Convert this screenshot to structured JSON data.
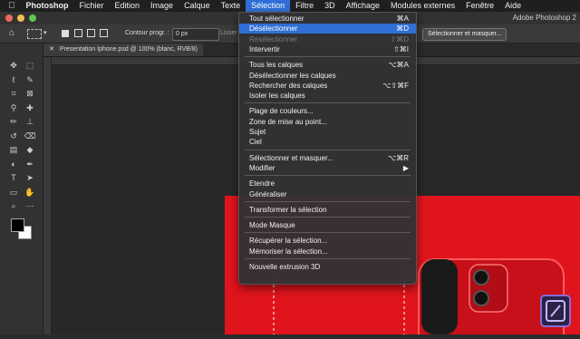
{
  "menubar": {
    "apple": "",
    "items": [
      "Photoshop",
      "Fichier",
      "Edition",
      "Image",
      "Calque",
      "Texte",
      "Sélection",
      "Filtre",
      "3D",
      "Affichage",
      "Modules externes",
      "Fenêtre",
      "Aide"
    ],
    "active": "Sélection",
    "colors": {
      "active": "#2f6fd6"
    }
  },
  "window": {
    "app_title": "Adobe Photoshop 2"
  },
  "options": {
    "contour_label": "Contour progr. :",
    "contour_value": "0 px",
    "lisser_label": "Lisser",
    "select_mask_button": "Sélectionner et masquer..."
  },
  "document": {
    "tab_label": "Presentation Iphone.psd @ 100% (blanc, RVB/8)"
  },
  "selection_menu": {
    "groups": [
      [
        {
          "label": "Tout sélectionner",
          "shortcut": "⌘A",
          "state": "normal"
        },
        {
          "label": "Désélectionner",
          "shortcut": "⌘D",
          "state": "highlighted"
        },
        {
          "label": "Resélectionner",
          "shortcut": "⇧⌘D",
          "state": "disabled"
        },
        {
          "label": "Intervertir",
          "shortcut": "⇧⌘I",
          "state": "normal"
        }
      ],
      [
        {
          "label": "Tous les calques",
          "shortcut": "⌥⌘A",
          "state": "normal"
        },
        {
          "label": "Désélectionner les calques",
          "shortcut": "",
          "state": "normal"
        },
        {
          "label": "Rechercher des calques",
          "shortcut": "⌥⇧⌘F",
          "state": "normal"
        },
        {
          "label": "Isoler les calques",
          "shortcut": "",
          "state": "normal"
        }
      ],
      [
        {
          "label": "Plage de couleurs...",
          "shortcut": "",
          "state": "normal"
        },
        {
          "label": "Zone de mise au point...",
          "shortcut": "",
          "state": "normal"
        },
        {
          "label": "Sujet",
          "shortcut": "",
          "state": "normal"
        },
        {
          "label": "Ciel",
          "shortcut": "",
          "state": "normal"
        }
      ],
      [
        {
          "label": "Sélectionner et masquer...",
          "shortcut": "⌥⌘R",
          "state": "normal"
        },
        {
          "label": "Modifier",
          "shortcut": "▶",
          "state": "normal"
        }
      ],
      [
        {
          "label": "Etendre",
          "shortcut": "",
          "state": "normal"
        },
        {
          "label": "Généraliser",
          "shortcut": "",
          "state": "normal"
        }
      ],
      [
        {
          "label": "Transformer la sélection",
          "shortcut": "",
          "state": "normal"
        }
      ],
      [
        {
          "label": "Mode Masque",
          "shortcut": "",
          "state": "normal"
        }
      ],
      [
        {
          "label": "Récupérer la sélection...",
          "shortcut": "",
          "state": "normal"
        },
        {
          "label": "Mémoriser la sélection...",
          "shortcut": "",
          "state": "normal"
        }
      ],
      [
        {
          "label": "Nouvelle extrusion 3D",
          "shortcut": "",
          "state": "normal"
        }
      ]
    ]
  },
  "toolbox": {
    "tools": [
      "move-tool",
      "marquee-tool",
      "lasso-tool",
      "quick-select-tool",
      "crop-tool",
      "frame-tool",
      "eyedropper-tool",
      "healing-brush-tool",
      "brush-tool",
      "clone-stamp-tool",
      "history-brush-tool",
      "eraser-tool",
      "gradient-tool",
      "blur-tool",
      "dodge-tool",
      "pen-tool",
      "type-tool",
      "path-select-tool",
      "rectangle-tool",
      "hand-tool",
      "zoom-tool",
      "more-tools"
    ],
    "foreground_color": "#000000",
    "background_color": "#ffffff"
  },
  "artwork_color": "#e0141c"
}
